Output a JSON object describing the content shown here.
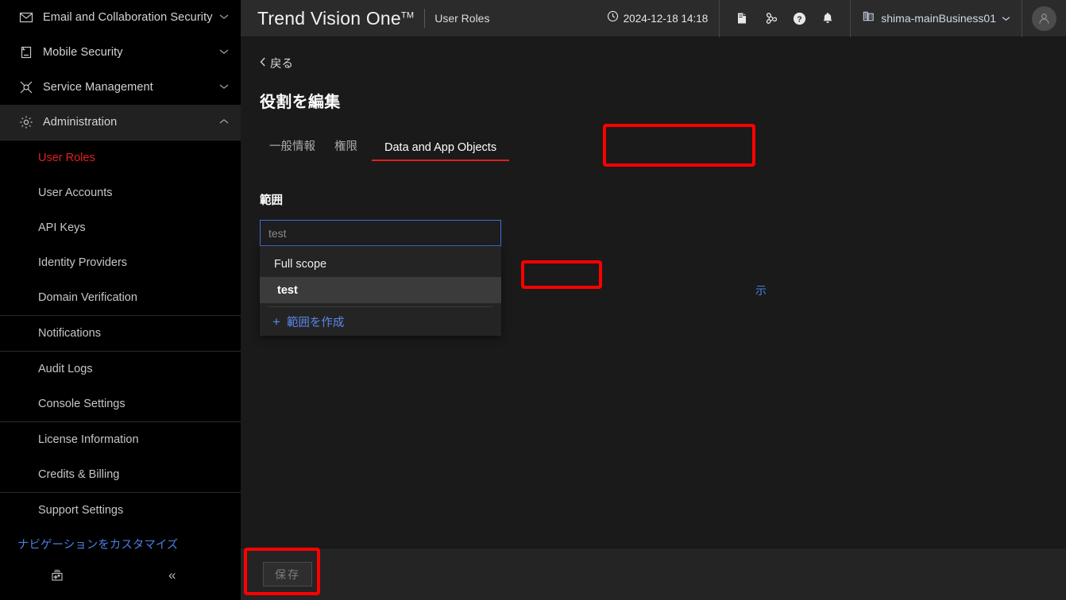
{
  "sidebar": {
    "groups": [
      {
        "items": [
          {
            "label": "Email and Collaboration Security",
            "icon": "envelope-icon",
            "chevron": "chevron-down-icon",
            "expanded": false
          },
          {
            "label": "Mobile Security",
            "icon": "mobile-device-icon",
            "chevron": "chevron-down-icon",
            "expanded": false
          },
          {
            "label": "Service Management",
            "icon": "service-management-icon",
            "chevron": "chevron-down-icon",
            "expanded": false
          },
          {
            "label": "Administration",
            "icon": "gear-icon",
            "chevron": "chevron-up-icon",
            "expanded": true
          }
        ]
      }
    ],
    "sub_groups": [
      {
        "items": [
          {
            "label": "User Roles",
            "selected": true
          },
          {
            "label": "User Accounts",
            "selected": false
          },
          {
            "label": "API Keys",
            "selected": false
          },
          {
            "label": "Identity Providers",
            "selected": false
          },
          {
            "label": "Domain Verification",
            "selected": false
          }
        ]
      },
      {
        "items": [
          {
            "label": "Notifications",
            "selected": false
          }
        ]
      },
      {
        "items": [
          {
            "label": "Audit Logs",
            "selected": false
          },
          {
            "label": "Console Settings",
            "selected": false
          }
        ]
      },
      {
        "items": [
          {
            "label": "License Information",
            "selected": false
          },
          {
            "label": "Credits & Billing",
            "selected": false
          }
        ]
      },
      {
        "items": [
          {
            "label": "Support Settings",
            "selected": false
          }
        ]
      }
    ],
    "customize_label": "ナビゲーションをカスタマイズ",
    "bottom": {
      "toolbox_icon": "toolbox-icon",
      "collapse_label": "«"
    },
    "colors": {
      "background": "#000000",
      "selected_text": "#e02020",
      "link": "#4a7fe0"
    }
  },
  "header": {
    "brand": "Trend Vision One",
    "brand_tm": "TM",
    "page_context": "User Roles",
    "clock_icon": "clock-icon",
    "datetime": "2024-12-18 14:18",
    "icons": [
      {
        "name": "docs-icon",
        "glyph": "book"
      },
      {
        "name": "support-icon",
        "glyph": "lifebuoy"
      },
      {
        "name": "help-icon",
        "glyph": "question-circle"
      },
      {
        "name": "notifications-bell-icon",
        "glyph": "bell"
      }
    ],
    "business": {
      "icon": "building-icon",
      "name": "shima-mainBusiness01",
      "chevron": "chevron-down-icon"
    },
    "avatar_icon": "user-avatar-icon",
    "background": "#2b2b2b"
  },
  "content": {
    "back_label": "戻る",
    "back_chevron": "chevron-left-icon",
    "page_title": "役割を編集",
    "tabs": [
      {
        "label": "一般情報",
        "active": false
      },
      {
        "label": "権限",
        "active": false
      },
      {
        "label": "Data and App Objects",
        "active": true
      }
    ],
    "scope": {
      "field_label": "範囲",
      "input_value": "",
      "input_placeholder": "test",
      "menu": {
        "options": [
          {
            "label": "Full scope",
            "type": "group",
            "highlighted": false
          },
          {
            "label": "test",
            "type": "child",
            "highlighted": true
          }
        ],
        "create_label": "範囲を作成",
        "create_icon": "plus-icon"
      },
      "obscured_text": "示"
    }
  },
  "footer": {
    "save_label": "保存",
    "save_disabled": true
  },
  "annotations": {
    "highlight_color": "#ff0000",
    "boxes": [
      {
        "name": "tab-data-and-app-objects"
      },
      {
        "name": "scope-option-test"
      },
      {
        "name": "save-button"
      }
    ]
  }
}
